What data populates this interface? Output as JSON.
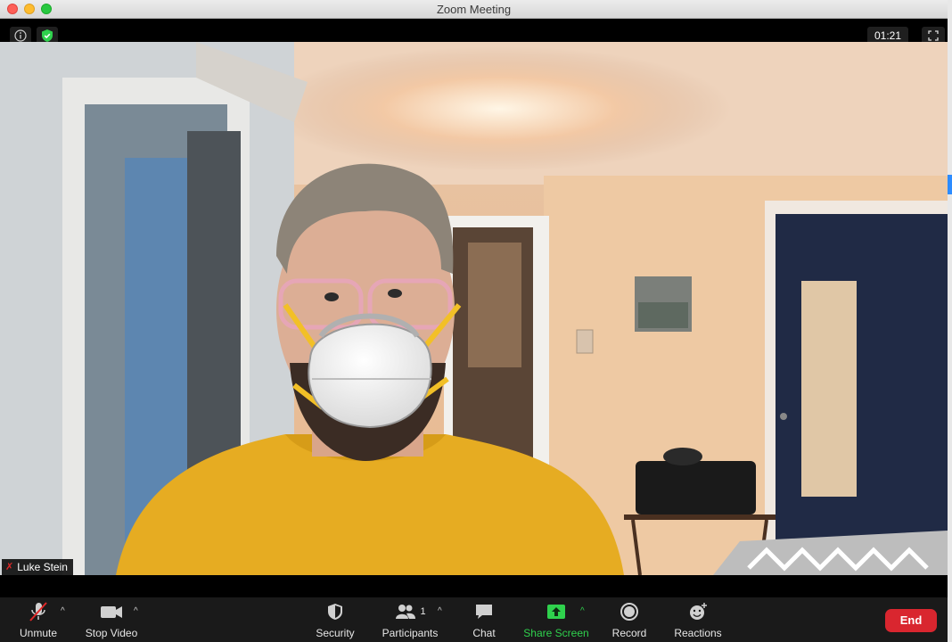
{
  "window": {
    "title": "Zoom Meeting"
  },
  "top_bar": {
    "info_icon": "info-icon",
    "security_icon": "shield-check-icon",
    "timer": "01:21",
    "fullscreen_icon": "fullscreen-icon"
  },
  "video": {
    "participant_name": "Luke Stein",
    "mic_state": "muted"
  },
  "toolbar": {
    "unmute_label": "Unmute",
    "stop_video_label": "Stop Video",
    "security_label": "Security",
    "participants_label": "Participants",
    "participants_count": "1",
    "chat_label": "Chat",
    "share_screen_label": "Share Screen",
    "record_label": "Record",
    "reactions_label": "Reactions",
    "end_label": "End"
  },
  "colors": {
    "share_green": "#2fd14d",
    "end_red": "#d9262f",
    "muted_red": "#e02828"
  }
}
